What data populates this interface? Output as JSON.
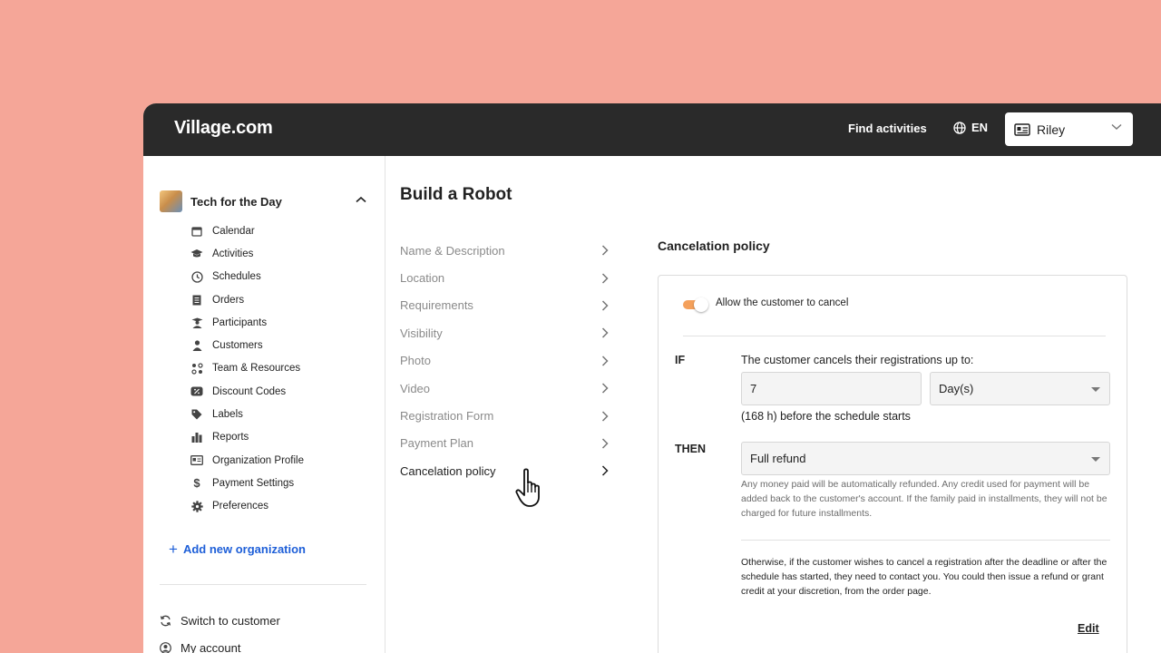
{
  "header": {
    "brand": "Village.com",
    "find_activities": "Find activities",
    "language": "EN",
    "user_name": "Riley"
  },
  "sidebar": {
    "org_name": "Tech for the Day",
    "items": [
      {
        "label": "Calendar",
        "icon": "calendar-icon"
      },
      {
        "label": "Activities",
        "icon": "graduation-cap-icon"
      },
      {
        "label": "Schedules",
        "icon": "clock-icon"
      },
      {
        "label": "Orders",
        "icon": "receipt-icon"
      },
      {
        "label": "Participants",
        "icon": "student-icon"
      },
      {
        "label": "Customers",
        "icon": "person-icon"
      },
      {
        "label": "Team & Resources",
        "icon": "team-icon"
      },
      {
        "label": "Discount Codes",
        "icon": "discount-icon"
      },
      {
        "label": "Labels",
        "icon": "tag-icon"
      },
      {
        "label": "Reports",
        "icon": "bar-chart-icon"
      },
      {
        "label": "Organization Profile",
        "icon": "id-card-icon"
      },
      {
        "label": "Payment Settings",
        "icon": "dollar-icon"
      },
      {
        "label": "Preferences",
        "icon": "gear-icon"
      }
    ],
    "add_org": "Add new organization",
    "switch_customer": "Switch to customer",
    "my_account": "My account"
  },
  "main": {
    "title": "Build a Robot",
    "steps": [
      "Name & Description",
      "Location",
      "Requirements",
      "Visibility",
      "Photo",
      "Video",
      "Registration Form",
      "Payment Plan",
      "Cancelation policy"
    ],
    "active_step": 8
  },
  "policy": {
    "section_title": "Cancelation policy",
    "toggle_label": "Allow the customer to cancel",
    "toggle_on": true,
    "if_label": "IF",
    "if_text": "The customer cancels their registrations up to:",
    "amount_value": "7",
    "unit_value": "Day(s)",
    "hours_text": "(168 h) before the schedule starts",
    "then_label": "THEN",
    "refund_value": "Full refund",
    "refund_help": "Any money paid will be automatically refunded. Any credit used for payment will be added back to the customer's account. If the family paid in installments, they will not be charged for future installments.",
    "otherwise_text": "Otherwise, if the customer wishes to cancel a registration after the deadline or after the schedule has started, they need to contact you. You could then issue a refund or grant credit at your discretion, from the order page.",
    "edit_label": "Edit"
  },
  "colors": {
    "background": "#F5A698",
    "topbar": "#2A2A2A",
    "accent_blue": "#1E5FD8",
    "toggle_orange": "#F4A05B"
  }
}
